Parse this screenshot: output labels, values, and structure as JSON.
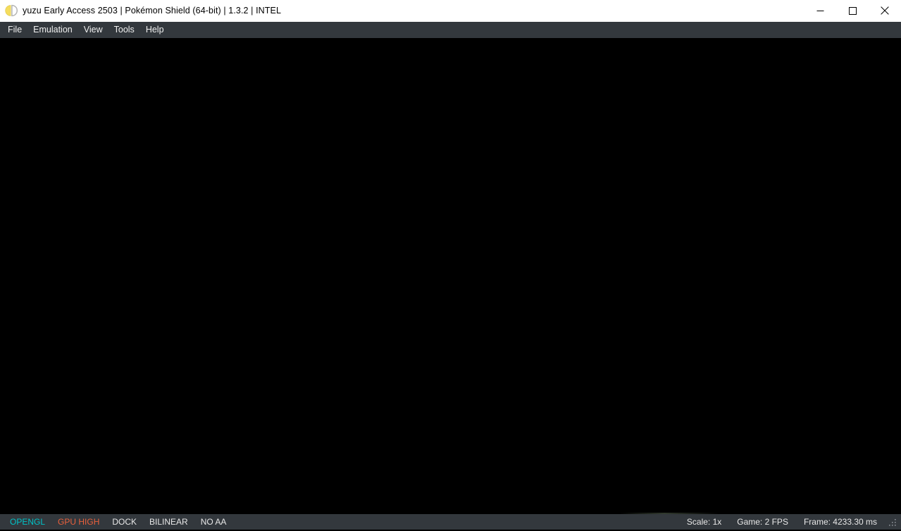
{
  "window": {
    "title": "yuzu Early Access 2503 | Pokémon Shield (64-bit) | 1.3.2 | INTEL",
    "icon": "yuzu-logo-icon",
    "controls": {
      "minimize": "minimize-icon",
      "maximize": "maximize-icon",
      "close": "close-icon"
    }
  },
  "menubar": {
    "items": [
      {
        "label": "File"
      },
      {
        "label": "Emulation"
      },
      {
        "label": "View"
      },
      {
        "label": "Tools"
      },
      {
        "label": "Help"
      }
    ]
  },
  "viewport": {
    "background": "#000000"
  },
  "statusbar": {
    "left": [
      {
        "label": "OPENGL",
        "color": "#00c2c7"
      },
      {
        "label": "GPU HIGH",
        "color": "#e8603c"
      },
      {
        "label": "DOCK",
        "color": "#e8e8e8"
      },
      {
        "label": "BILINEAR",
        "color": "#e8e8e8"
      },
      {
        "label": "NO AA",
        "color": "#e8e8e8"
      }
    ],
    "right": [
      {
        "label": "Scale: 1x"
      },
      {
        "label": "Game: 2 FPS"
      },
      {
        "label": "Frame: 4233.30 ms"
      }
    ],
    "grip": "resize-grip-icon"
  },
  "colors": {
    "titlebar_bg": "#ffffff",
    "chrome_bg": "#33383d",
    "viewport_bg": "#000000",
    "text_light": "#f0f0f0",
    "accent_opengl": "#00c2c7",
    "accent_gpu_high": "#e8603c",
    "logo_yellow": "#f5dd5e",
    "logo_gray": "#b4b4b4"
  }
}
